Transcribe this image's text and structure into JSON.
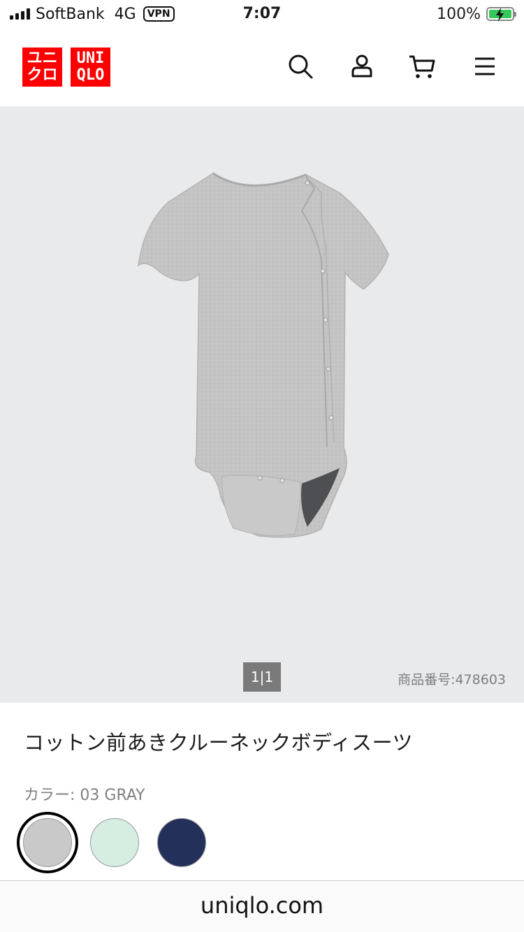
{
  "status_bar": {
    "carrier": "SoftBank",
    "network": "4G",
    "vpn": "VPN",
    "time": "7:07",
    "battery": "100%",
    "battery_level": 1.0
  },
  "header": {
    "logo_kana_line1": "ユニ",
    "logo_kana_line2": "クロ",
    "logo_latin_line1": "UNI",
    "logo_latin_line2": "QLO",
    "brand_color": "#ff0000",
    "icons": [
      "search-icon",
      "account-icon",
      "cart-icon",
      "menu-icon"
    ]
  },
  "gallery": {
    "counter": "1|1",
    "product_number": "商品番号:478603"
  },
  "product": {
    "title": "コットン前あきクルーネックボディスーツ",
    "color_label": "カラー: 03 GRAY",
    "swatches": [
      {
        "name": "GRAY",
        "color": "#c9c9c9",
        "selected": true
      },
      {
        "name": "MINT",
        "color": "#d6ede2",
        "selected": false
      },
      {
        "name": "NAVY",
        "color": "#23305a",
        "selected": false
      }
    ]
  },
  "browser": {
    "url": "uniqlo.com"
  }
}
